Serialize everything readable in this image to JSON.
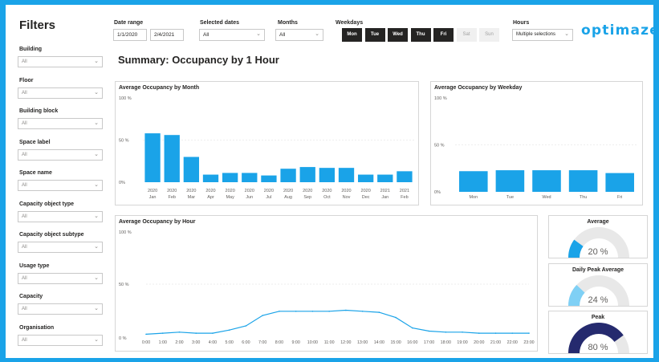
{
  "filters": {
    "title": "Filters",
    "items": [
      {
        "label": "Building",
        "value": "All"
      },
      {
        "label": "Floor",
        "value": "All"
      },
      {
        "label": "Building block",
        "value": "All"
      },
      {
        "label": "Space label",
        "value": "All"
      },
      {
        "label": "Space name",
        "value": "All"
      },
      {
        "label": "Capacity object type",
        "value": "All"
      },
      {
        "label": "Capacity object subtype",
        "value": "All"
      },
      {
        "label": "Usage type",
        "value": "All"
      },
      {
        "label": "Capacity",
        "value": "All"
      },
      {
        "label": "Organisation",
        "value": "All"
      }
    ]
  },
  "header": {
    "date_range_label": "Date range",
    "date_start": "1/1/2020",
    "date_end": "2/4/2021",
    "selected_dates_label": "Selected dates",
    "selected_dates_value": "All",
    "months_label": "Months",
    "months_value": "All",
    "weekdays_label": "Weekdays",
    "weekdays": [
      {
        "label": "Mon",
        "selected": true
      },
      {
        "label": "Tue",
        "selected": true
      },
      {
        "label": "Wed",
        "selected": true
      },
      {
        "label": "Thu",
        "selected": true
      },
      {
        "label": "Fri",
        "selected": true
      },
      {
        "label": "Sat",
        "selected": false
      },
      {
        "label": "Sun",
        "selected": false
      }
    ],
    "hours_label": "Hours",
    "hours_value": "Multiple selections",
    "logo_text": "optimaze"
  },
  "page_title": "Summary: Occupancy by 1 Hour",
  "colors": {
    "accent": "#1aa3e8",
    "bar": "#1aa3e8",
    "gauge_track": "#e8e8e8",
    "gauge_light": "#7fd0f5",
    "gauge_dark": "#252a6e"
  },
  "chart_data": [
    {
      "type": "bar",
      "title": "Average Occupancy by Month",
      "categories": [
        "2020 Jan",
        "2020 Feb",
        "2020 Mar",
        "2020 Apr",
        "2020 May",
        "2020 Jun",
        "2020 Jul",
        "2020 Aug",
        "2020 Sep",
        "2020 Oct",
        "2020 Nov",
        "2020 Dec",
        "2021 Jan",
        "2021 Feb"
      ],
      "tick_labels": [
        [
          "2020",
          "Jan"
        ],
        [
          "2020",
          "Feb"
        ],
        [
          "2020",
          "Mar"
        ],
        [
          "2020",
          "Apr"
        ],
        [
          "2020",
          "May"
        ],
        [
          "2020",
          "Jun"
        ],
        [
          "2020",
          "Jul"
        ],
        [
          "2020",
          "Aug"
        ],
        [
          "2020",
          "Sep"
        ],
        [
          "2020",
          "Oct"
        ],
        [
          "2020",
          "Nov"
        ],
        [
          "2020",
          "Dec"
        ],
        [
          "2021",
          "Jan"
        ],
        [
          "2021",
          "Feb"
        ]
      ],
      "values": [
        58,
        56,
        30,
        9,
        11,
        11,
        8,
        16,
        18,
        17,
        17,
        9,
        9,
        13
      ],
      "ylim": [
        0,
        100
      ],
      "yticks": [
        "0%",
        "50 %",
        "100 %"
      ]
    },
    {
      "type": "bar",
      "title": "Average Occupancy by Weekday",
      "categories": [
        "Mon",
        "Tue",
        "Wed",
        "Thu",
        "Fri"
      ],
      "values": [
        22,
        23,
        23,
        23,
        20
      ],
      "ylim": [
        0,
        100
      ],
      "yticks": [
        "0%",
        "50 %",
        "100 %"
      ]
    },
    {
      "type": "line",
      "title": "Average Occupancy by Hour",
      "x": [
        "0:00",
        "1:00",
        "2:00",
        "3:00",
        "4:00",
        "5:00",
        "6:00",
        "7:00",
        "8:00",
        "9:00",
        "10:00",
        "11:00",
        "12:00",
        "13:00",
        "14:00",
        "15:00",
        "16:00",
        "17:00",
        "18:00",
        "19:00",
        "20:00",
        "21:00",
        "22:00",
        "23:00"
      ],
      "values": [
        2,
        3,
        4,
        3,
        3,
        6,
        10,
        20,
        24,
        24,
        24,
        24,
        25,
        24,
        23,
        18,
        8,
        5,
        4,
        4,
        3,
        3,
        3,
        3
      ],
      "ylim": [
        0,
        100
      ],
      "yticks": [
        "0 %",
        "50 %",
        "100 %"
      ]
    }
  ],
  "gauges": [
    {
      "title": "Average",
      "value": 20,
      "display": "20 %",
      "color": "#1aa3e8"
    },
    {
      "title": "Daily Peak Average",
      "value": 24,
      "display": "24 %",
      "color": "#7fd0f5"
    },
    {
      "title": "Peak",
      "value": 80,
      "display": "80 %",
      "color": "#252a6e"
    }
  ]
}
